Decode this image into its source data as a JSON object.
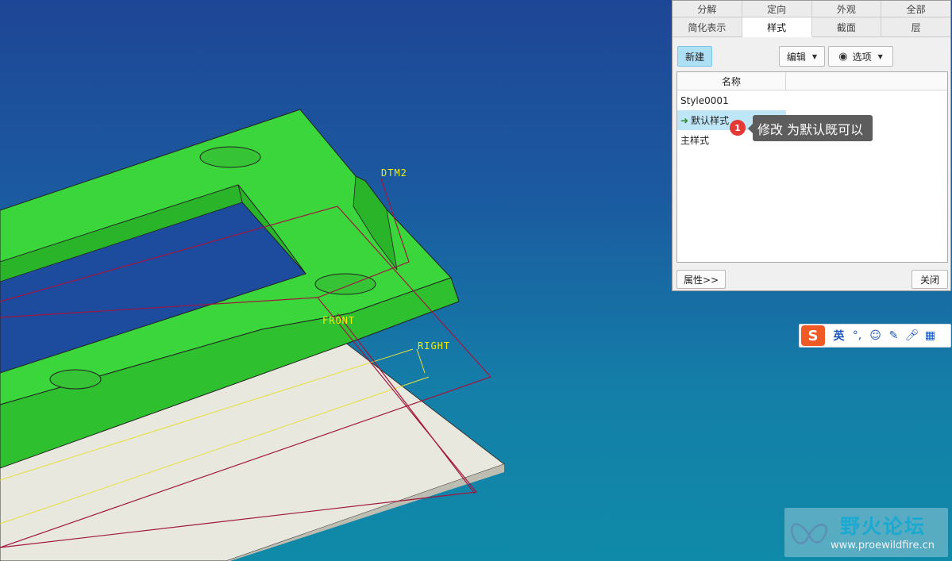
{
  "viewport": {
    "datum_labels": [
      "DTM2",
      "FRONT",
      "RIGHT"
    ],
    "colors": {
      "part_color": "#37d337",
      "plate_color": "#e8e8df",
      "datum_color": "#a0173f"
    }
  },
  "view_manager": {
    "tabs_row1": [
      "分解",
      "定向",
      "外观",
      "全部"
    ],
    "tabs_row2": [
      "简化表示",
      "样式",
      "截面",
      "层"
    ],
    "active_tab": "样式",
    "new_label": "新建",
    "edit_label": "编辑",
    "options_label": "选项",
    "list_header": "名称",
    "items": [
      {
        "label": "Style0001"
      },
      {
        "label": "默认样式",
        "icon": "green-arrow-icon",
        "selected": true
      },
      {
        "label": "主样式"
      }
    ],
    "properties_label": "属性>>",
    "close_label": "关闭"
  },
  "annotation": {
    "badge": "1",
    "text": "修改 为默认既可以"
  },
  "ime_toolbar": {
    "logo": "S",
    "lang": "英",
    "punct": "°,",
    "icons": [
      "emoji-icon",
      "pen-icon",
      "mic-icon",
      "grid-icon"
    ]
  },
  "watermark": {
    "title": "野火论坛",
    "url": "www.proewildfire.cn"
  }
}
